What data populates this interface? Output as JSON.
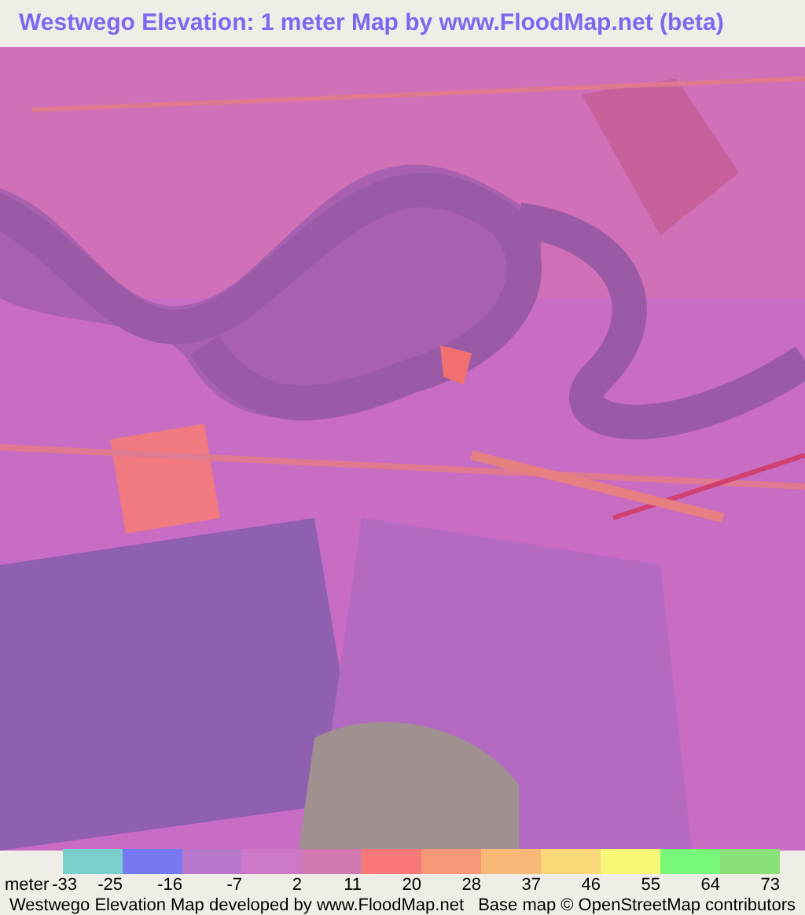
{
  "title": "Westwego Elevation: 1 meter Map by www.FloodMap.net (beta)",
  "legend": {
    "unit": "meter",
    "first_tick": "-33",
    "bins": [
      {
        "color": "#7acfcc",
        "tick": "-25"
      },
      {
        "color": "#7878f0",
        "tick": "-16"
      },
      {
        "color": "#b879cc",
        "tick": "-7"
      },
      {
        "color": "#cc7ac8",
        "tick": "2"
      },
      {
        "color": "#d07ab0",
        "tick": "11"
      },
      {
        "color": "#f87878",
        "tick": "20"
      },
      {
        "color": "#f89878",
        "tick": "28"
      },
      {
        "color": "#f8b878",
        "tick": "37"
      },
      {
        "color": "#f8d878",
        "tick": "46"
      },
      {
        "color": "#f8f878",
        "tick": "55"
      },
      {
        "color": "#78f878",
        "tick": "64"
      },
      {
        "color": "#8ae078",
        "tick": "73"
      }
    ]
  },
  "footer": {
    "left": "Westwego Elevation Map developed by www.FloodMap.net",
    "right": "Base map © OpenStreetMap contributors"
  }
}
